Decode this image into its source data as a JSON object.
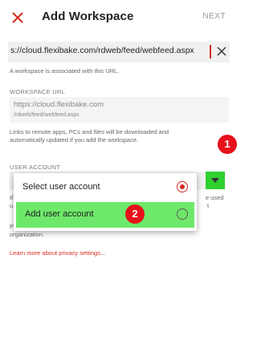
{
  "colors": {
    "accent": "#d62b1f",
    "highlight_green": "#6ee86a",
    "dropdown_green": "#2fd02f",
    "badge_red": "#e8101a"
  },
  "header": {
    "close_icon": "close-icon",
    "title": "Add Workspace",
    "next_label": "NEXT"
  },
  "url_input": {
    "value": "s://cloud.flexibake.com/rdweb/feed/webfeed.aspx",
    "clear_icon": "clear-icon",
    "hint": "A workspace is associated with this URL."
  },
  "workspace_url": {
    "label": "WORKSPACE URL",
    "line1": "https://cloud.flexibake.com",
    "line2": "/rdweb/feed/webfeed.aspx",
    "note_line1": "Links to remote apps, PCs and files will be downloaded and",
    "note_line2": "automatically updated if you add the workspace."
  },
  "user_account": {
    "label": "USER ACCOUNT",
    "dropdown_icon": "chevron-down-icon",
    "obscured_left_1": "If",
    "obscured_left_2": "u",
    "obscured_right_1": "e used",
    "obscured_right_2": "t"
  },
  "privacy": {
    "text_line1": "Privacy settings for managed resources have been preset by your",
    "text_line2": "organization.",
    "link": "Learn more about privacy settings..."
  },
  "popup": {
    "options": [
      {
        "label": "Select user account",
        "selected": true
      },
      {
        "label": "Add user account",
        "selected": false
      }
    ]
  },
  "badges": {
    "one": "1",
    "two": "2"
  }
}
